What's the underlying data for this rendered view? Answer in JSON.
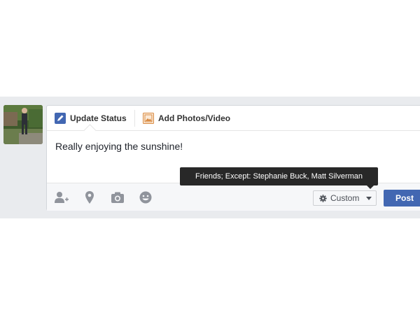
{
  "composer": {
    "tabs": [
      {
        "label": "Update Status",
        "icon": "pencil-icon"
      },
      {
        "label": "Add Photos/Video",
        "icon": "photo-icon"
      }
    ],
    "status_text": "Really enjoying the sunshine!",
    "footer_icons": [
      "tag-friends-icon",
      "location-pin-icon",
      "camera-icon",
      "feeling-smiley-icon"
    ],
    "privacy": {
      "label": "Custom",
      "tooltip": "Friends; Except: Stephanie Buck, Matt Silverman",
      "icon": "gear-icon"
    },
    "post_label": "Post"
  },
  "colors": {
    "brand_blue": "#4267b2",
    "feed_background": "#e9ebee",
    "tooltip_background": "#282828"
  }
}
